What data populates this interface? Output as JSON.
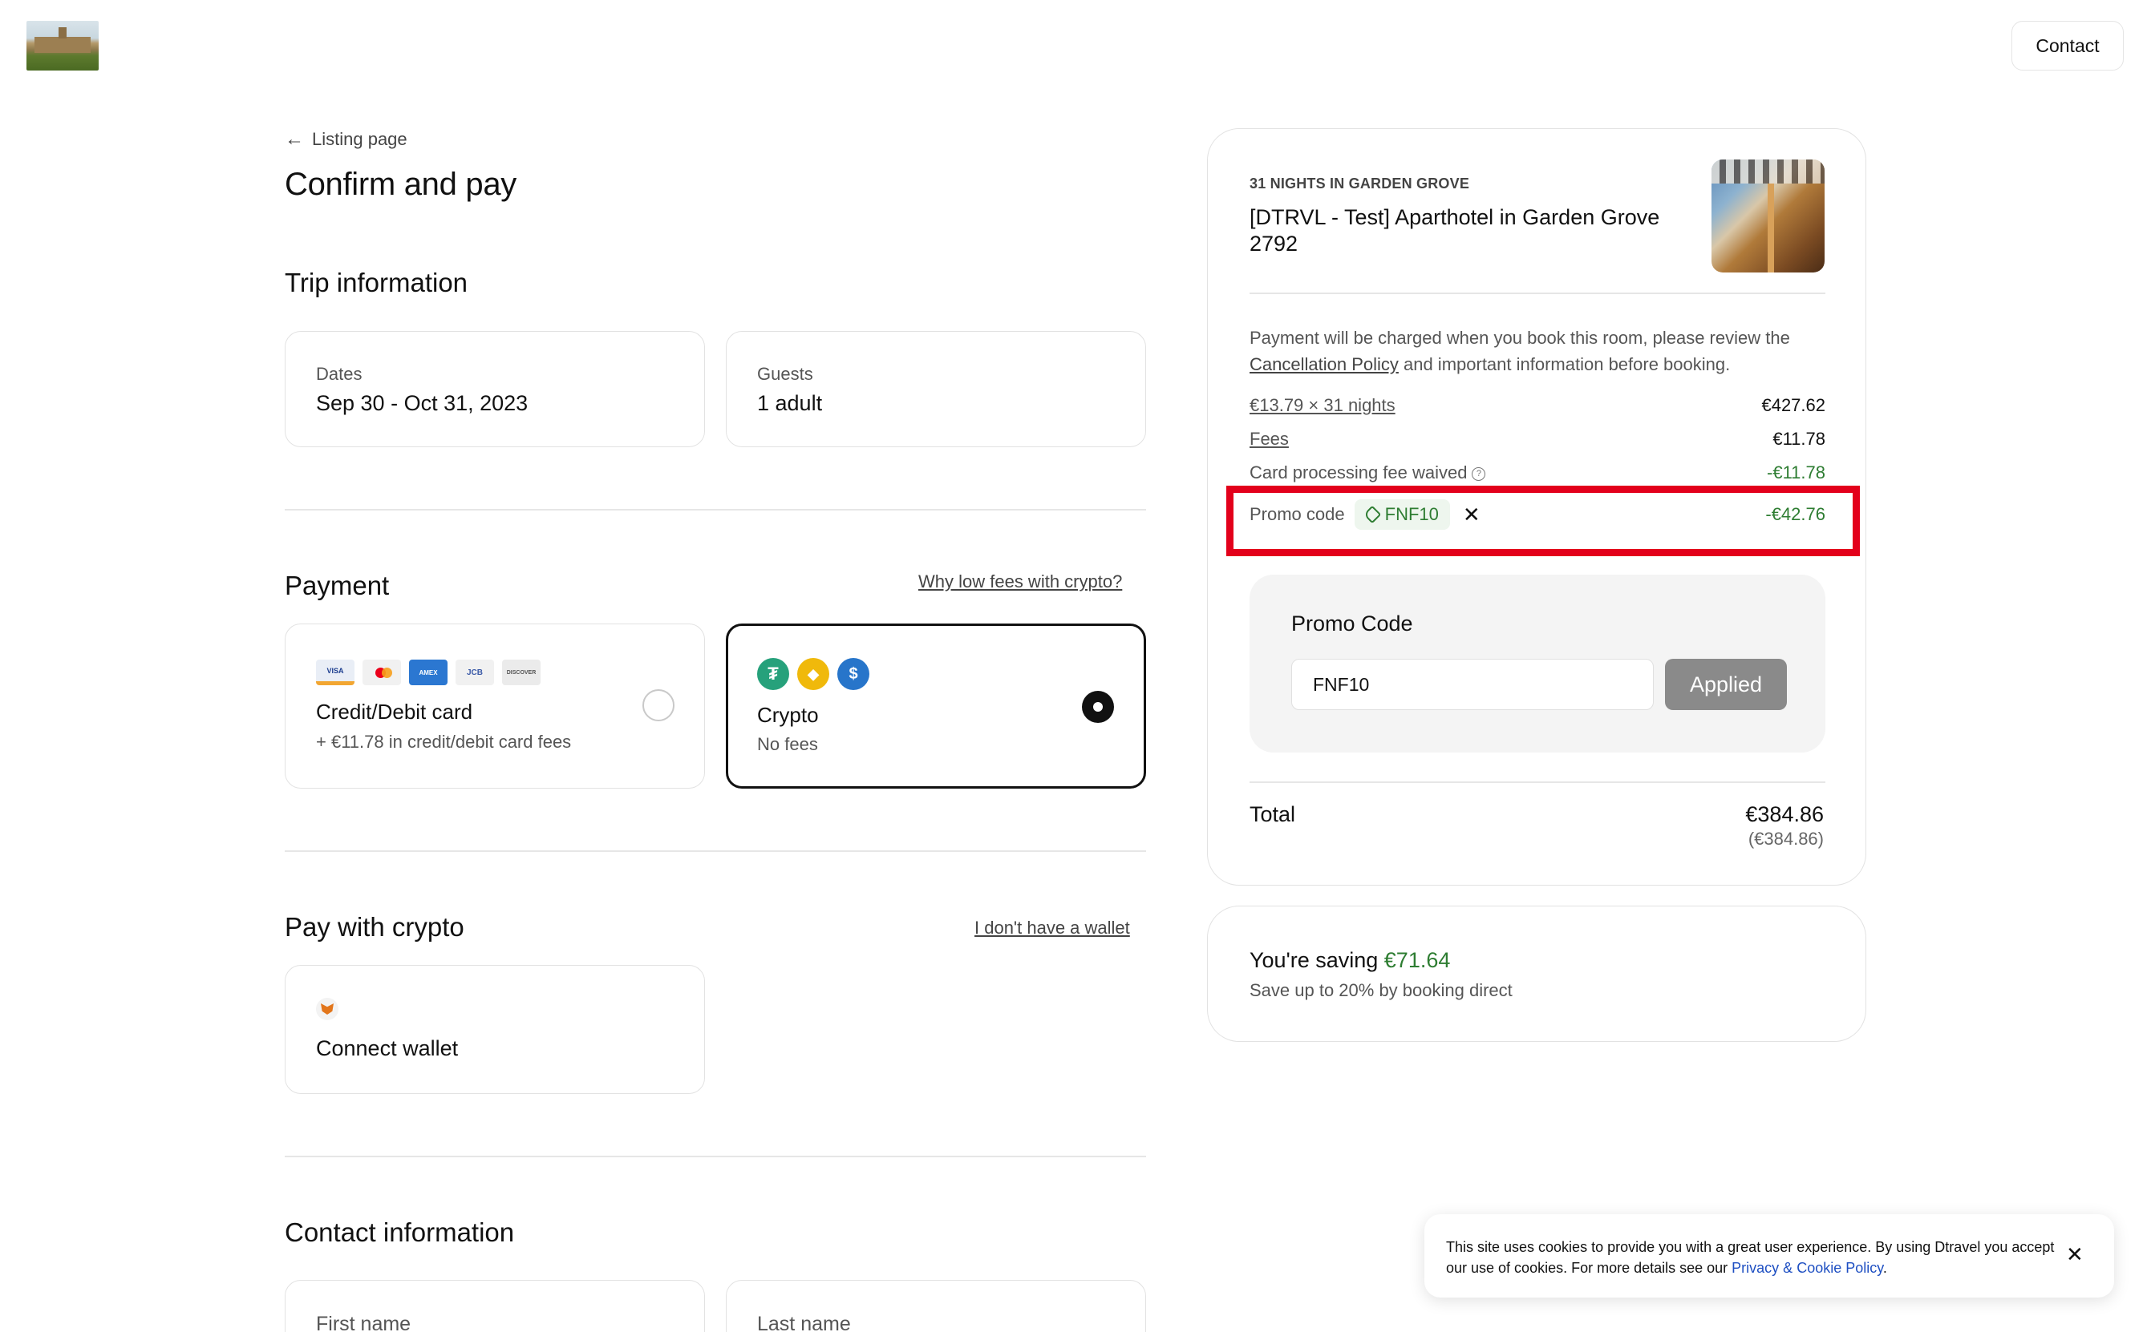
{
  "header": {
    "contact_label": "Contact"
  },
  "nav": {
    "back_label": "Listing page"
  },
  "page": {
    "title": "Confirm and pay"
  },
  "trip": {
    "title": "Trip information",
    "dates_label": "Dates",
    "dates_value": "Sep 30 - Oct 31, 2023",
    "guests_label": "Guests",
    "guests_value": "1 adult"
  },
  "payment": {
    "title": "Payment",
    "why_link": "Why low fees with crypto?",
    "card_option": {
      "label": "Credit/Debit card",
      "sub": "+ €11.78 in credit/debit card fees",
      "selected": false,
      "icons": [
        "visa-icon",
        "mastercard-icon",
        "amex-icon",
        "jcb-icon",
        "discover-icon"
      ]
    },
    "crypto_option": {
      "label": "Crypto",
      "sub": "No fees",
      "selected": true,
      "icons": [
        "usdt-icon",
        "busd-icon",
        "usdc-icon"
      ]
    }
  },
  "pay_crypto": {
    "title": "Pay with crypto",
    "no_wallet_link": "I don't have a wallet",
    "connect_label": "Connect wallet"
  },
  "contact_info": {
    "title": "Contact information",
    "first_name": "First name",
    "last_name": "Last name"
  },
  "summary": {
    "nights": "31 NIGHTS IN GARDEN GROVE",
    "hotel_name": "[DTRVL - Test] Aparthotel in Garden Grove 2792",
    "notice_pre": "Payment will be charged when you book this room, please review the ",
    "notice_link": "Cancellation Policy",
    "notice_post": " and important information before booking.",
    "rate_label": "€13.79 × 31 nights",
    "rate_amount": "€427.62",
    "fees_label": "Fees",
    "fees_amount": "€11.78",
    "waived_label": "Card processing fee waived",
    "waived_amount": "-€11.78",
    "promo_label": "Promo code",
    "promo_code": "FNF10",
    "promo_amount": "-€42.76",
    "promo_box_title": "Promo Code",
    "promo_input_value": "FNF10",
    "applied_label": "Applied",
    "total_label": "Total",
    "total_amount": "€384.86",
    "total_sub": "(€384.86)"
  },
  "saving": {
    "prefix": "You're saving ",
    "amount": "€71.64",
    "sub": "Save up to 20% by booking direct"
  },
  "cookie": {
    "text": "This site uses cookies to provide you with a great user experience. By using Dtravel you accept our use of cookies. For more details see our ",
    "link": "Privacy & Cookie Policy",
    "end": "."
  },
  "colors": {
    "accent_green": "#2e7d32",
    "highlight_red": "#e3001b",
    "applied_gray": "#8a8a8a"
  }
}
